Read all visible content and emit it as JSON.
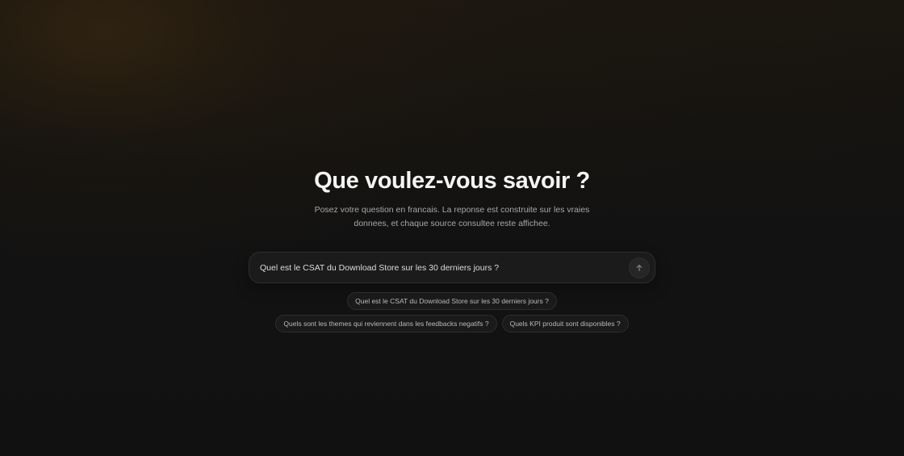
{
  "hero": {
    "title": "Que voulez-vous savoir ?",
    "subtitle": "Posez votre question en francais. La reponse est construite sur les vraies donnees, et chaque source consultee reste affichee."
  },
  "search": {
    "value": "Quel est le CSAT du Download Store sur les 30 derniers jours ?",
    "placeholder": "",
    "send_icon": "arrow-up-icon"
  },
  "suggestions": [
    "Quel est le CSAT du Download Store sur les 30 derniers jours ?",
    "Quels sont les themes qui reviennent dans les feedbacks negatifs ?",
    "Quels KPI produit sont disponibles ?"
  ],
  "colors": {
    "background": "#111111",
    "accent_glow": "#402c12",
    "text_primary": "#f4f4f4",
    "text_secondary": "#a7a7a7"
  }
}
